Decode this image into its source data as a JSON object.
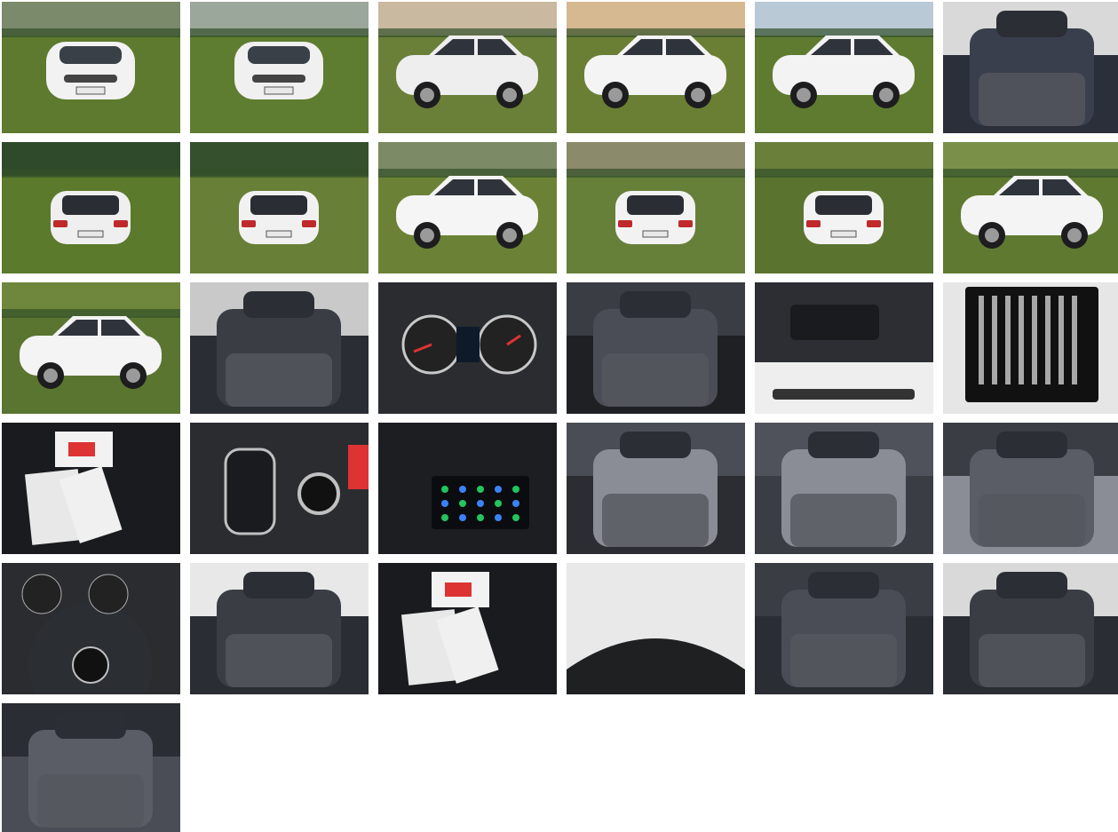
{
  "gallery": {
    "photos": [
      {
        "subject": "car-exterior-front-left",
        "scene": "grass-car",
        "palette": {
          "top": "#7a8a6a",
          "bottom": "#5d7a2e",
          "car": "#f2f2f2"
        },
        "view": "front"
      },
      {
        "subject": "car-exterior-front",
        "scene": "grass-car",
        "palette": {
          "top": "#9aa79a",
          "bottom": "#5f7d30",
          "car": "#f0f0f0"
        },
        "view": "front"
      },
      {
        "subject": "car-exterior-front-right",
        "scene": "grass-car",
        "palette": {
          "top": "#c9b9a0",
          "bottom": "#6a7f38",
          "car": "#eeeeee"
        },
        "view": "three-quarter"
      },
      {
        "subject": "car-exterior-side-front",
        "scene": "grass-car",
        "palette": {
          "top": "#d6b891",
          "bottom": "#6a7f34",
          "car": "#f4f4f4"
        },
        "view": "three-quarter"
      },
      {
        "subject": "car-exterior-side",
        "scene": "grass-car",
        "palette": {
          "top": "#b9c9d6",
          "bottom": "#5e7b30",
          "car": "#f3f3f3"
        },
        "view": "side"
      },
      {
        "subject": "car-interior-front-seat",
        "scene": "interior",
        "palette": {
          "top": "#d9d9d9",
          "bottom": "#2b2f3a",
          "car": "#3a3f4d"
        },
        "view": "seat"
      },
      {
        "subject": "car-exterior-rear",
        "scene": "grass-car",
        "palette": {
          "top": "#2f4a2a",
          "bottom": "#5b7a2c",
          "car": "#efefef"
        },
        "view": "rear"
      },
      {
        "subject": "car-exterior-rear-left",
        "scene": "grass-car",
        "palette": {
          "top": "#34502c",
          "bottom": "#677f36",
          "car": "#f1f1f1"
        },
        "view": "rear"
      },
      {
        "subject": "car-exterior-side-full",
        "scene": "grass-car",
        "palette": {
          "top": "#7d8a66",
          "bottom": "#6b8236",
          "car": "#f5f5f5"
        },
        "view": "side"
      },
      {
        "subject": "car-exterior-rear-right",
        "scene": "grass-car",
        "palette": {
          "top": "#8b8a6a",
          "bottom": "#66803a",
          "car": "#f2f2f2"
        },
        "view": "rear"
      },
      {
        "subject": "car-exterior-rear-top",
        "scene": "grass-car",
        "palette": {
          "top": "#6a7f3a",
          "bottom": "#5a7430",
          "car": "#f3f3f3"
        },
        "view": "rear"
      },
      {
        "subject": "car-exterior-front-right-low",
        "scene": "grass-car",
        "palette": {
          "top": "#7a8f48",
          "bottom": "#5f7a30",
          "car": "#f4f4f4"
        },
        "view": "three-quarter"
      },
      {
        "subject": "car-exterior-front-right-close",
        "scene": "grass-car",
        "palette": {
          "top": "#6f873c",
          "bottom": "#5a7530",
          "car": "#f4f4f4"
        },
        "view": "three-quarter"
      },
      {
        "subject": "car-interior-rear-seats",
        "scene": "interior",
        "palette": {
          "top": "#c9c9c9",
          "bottom": "#2a2d33",
          "car": "#3a3d44"
        },
        "view": "seat"
      },
      {
        "subject": "car-instrument-cluster",
        "scene": "dash",
        "palette": {
          "top": "#2a2c30",
          "bottom": "#1a1c20",
          "car": "#c8c8c8"
        },
        "view": "gauges"
      },
      {
        "subject": "car-interior-gear-shifter",
        "scene": "interior",
        "palette": {
          "top": "#3a3d44",
          "bottom": "#1e2024",
          "car": "#4a4d55"
        },
        "view": "seat"
      },
      {
        "subject": "car-engine-bay",
        "scene": "engine",
        "palette": {
          "top": "#2c2e33",
          "bottom": "#eeeeee",
          "car": "#1e1f22"
        },
        "view": "engine"
      },
      {
        "subject": "car-vin-plate",
        "scene": "plate",
        "palette": {
          "top": "#111111",
          "bottom": "#e6e6e6",
          "car": "#111111"
        },
        "view": "plate"
      },
      {
        "subject": "car-documents-brochure",
        "scene": "documents",
        "palette": {
          "top": "#2a2c30",
          "bottom": "#1a1b1e",
          "car": "#e8e8e8"
        },
        "view": "docs"
      },
      {
        "subject": "car-dashboard-buttons",
        "scene": "dash",
        "palette": {
          "top": "#2a2c30",
          "bottom": "#1a1c20",
          "car": "#c0c0c0"
        },
        "view": "buttons"
      },
      {
        "subject": "car-infotainment-screen",
        "scene": "dash",
        "palette": {
          "top": "#1c1e22",
          "bottom": "#2a2c30",
          "car": "#3c6fd8"
        },
        "view": "screen"
      },
      {
        "subject": "car-light-switch",
        "scene": "interior",
        "palette": {
          "top": "#4a4d55",
          "bottom": "#2b2d32",
          "car": "#8a8d95"
        },
        "view": "panel"
      },
      {
        "subject": "car-door-panel",
        "scene": "interior",
        "palette": {
          "top": "#4f525a",
          "bottom": "#3a3d44",
          "car": "#8a8d95"
        },
        "view": "panel"
      },
      {
        "subject": "car-seat-fabric",
        "scene": "interior",
        "palette": {
          "top": "#3a3d44",
          "bottom": "#8a8d95",
          "car": "#5a5d65"
        },
        "view": "fabric"
      },
      {
        "subject": "car-steering-wheel",
        "scene": "dash",
        "palette": {
          "top": "#2a2c30",
          "bottom": "#1a1c20",
          "car": "#bfbfbf"
        },
        "view": "wheel"
      },
      {
        "subject": "car-interior-rear-view",
        "scene": "interior",
        "palette": {
          "top": "#e8e8e8",
          "bottom": "#2a2d33",
          "car": "#3a3d44"
        },
        "view": "seat"
      },
      {
        "subject": "car-documents-brochure-2",
        "scene": "documents",
        "palette": {
          "top": "#2a2c30",
          "bottom": "#1a1b1e",
          "car": "#e8e8e8"
        },
        "view": "docs"
      },
      {
        "subject": "car-wheel-arch",
        "scene": "detail",
        "palette": {
          "top": "#e9e9e9",
          "bottom": "#1f2022",
          "car": "#dcdcdc"
        },
        "view": "wheel-arch"
      },
      {
        "subject": "car-rear-seat-belts",
        "scene": "interior",
        "palette": {
          "top": "#3a3d44",
          "bottom": "#2a2d33",
          "car": "#4a4d55"
        },
        "view": "seat"
      },
      {
        "subject": "car-front-seats-door-open",
        "scene": "interior",
        "palette": {
          "top": "#d9d9d9",
          "bottom": "#2a2d33",
          "car": "#3a3d44"
        },
        "view": "seat"
      },
      {
        "subject": "car-front-seat-cushion",
        "scene": "interior",
        "palette": {
          "top": "#2a2d33",
          "bottom": "#4a4d55",
          "car": "#5a5d65"
        },
        "view": "seat"
      }
    ]
  }
}
